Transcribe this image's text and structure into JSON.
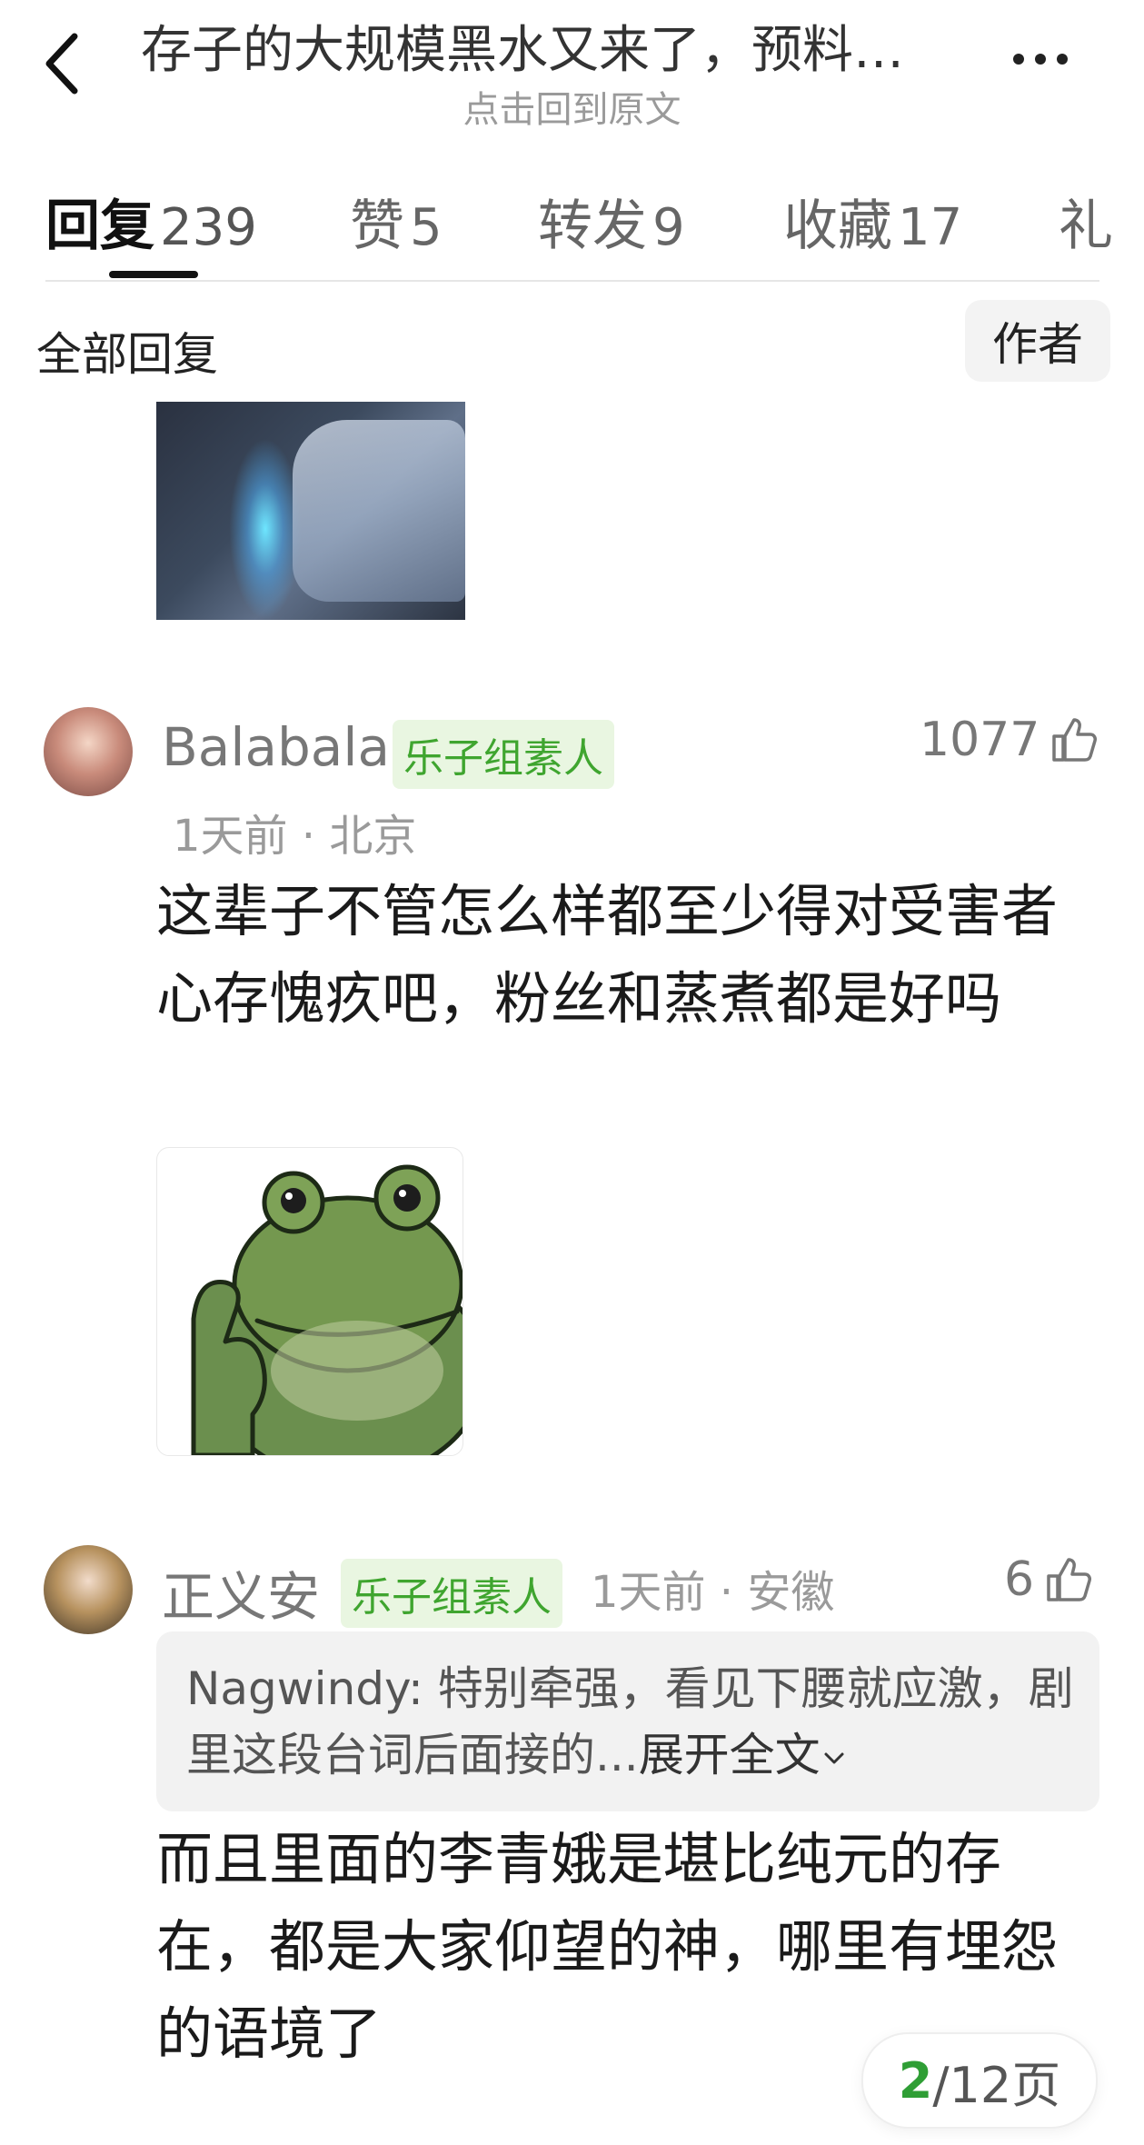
{
  "header": {
    "title": "存子的大规模黑水又来了，预料…",
    "subtitle": "点击回到原文"
  },
  "tabs": [
    {
      "label": "回复",
      "count": "239"
    },
    {
      "label": "赞",
      "count": "5"
    },
    {
      "label": "转发",
      "count": "9"
    },
    {
      "label": "收藏",
      "count": "17"
    },
    {
      "label": "礼",
      "count": ""
    }
  ],
  "filter": {
    "all_replies": "全部回复",
    "author": "作者"
  },
  "comments": [
    {
      "username": "Balabala",
      "badge": "乐子组素人",
      "likes": "1077",
      "meta": "1天前 · 北京",
      "text": "这辈子不管怎么样都至少得对受害者心存愧疚吧，粉丝和蒸煮都是好吗"
    },
    {
      "username": "正义安",
      "badge": "乐子组素人",
      "likes": "6",
      "meta": "1天前 · 安徽",
      "quote_user": "Nagwindy: ",
      "quote_text": "特别牵强，看见下腰就应激，剧里这段台词后面接的...",
      "quote_expand": "展开全文",
      "text": "而且里面的李青娥是堪比纯元的存在，都是大家仰望的神，哪里有埋怨的语境了"
    }
  ],
  "pager": {
    "current": "2",
    "total": "/12页"
  },
  "colors": {
    "badge_text": "#3fa52f",
    "badge_bg": "#e9f6e1",
    "pager_current": "#2f9e35"
  }
}
